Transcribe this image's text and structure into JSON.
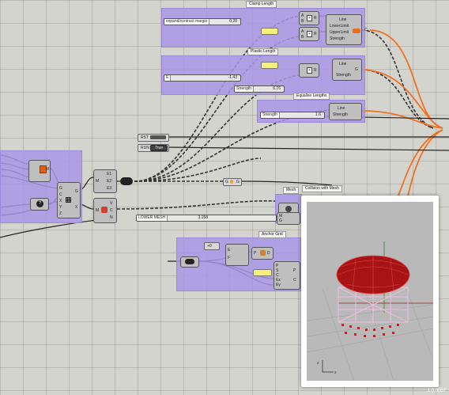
{
  "groups": {
    "clamp": "Clamp Length",
    "plastic": "Plastic Length",
    "equalise": "Equalise Lengths",
    "collision": "Collision with Mesh",
    "mesh": "Mesh",
    "anchor": "Anchor Grid"
  },
  "clamp": {
    "slider_label": "expand/contract margin",
    "slider_value": "0.20",
    "outputs": [
      "Line",
      "LowerLimit",
      "UpperLimit",
      "Strength"
    ],
    "inputs1": [
      "A",
      "B"
    ],
    "inputs2": [
      "A",
      "B"
    ],
    "out_r": "R",
    "out_c": "C"
  },
  "plastic": {
    "slider_label": "E",
    "slider_value": "-1.43",
    "strength_label": "Strength",
    "strength_value": "6.76",
    "outputs": [
      "Line",
      "Strength"
    ],
    "out_r": "R",
    "out_g": "G"
  },
  "equalise": {
    "strength_label": "Strength",
    "strength_value": "1.6",
    "outputs": [
      "Line",
      "Strength"
    ]
  },
  "controls": {
    "rst": "RST",
    "run": "RUN",
    "run_value": "True"
  },
  "left": {
    "inputs": [
      "G",
      "C",
      "X",
      "Y",
      "Z"
    ],
    "outputs": [
      "G",
      "X"
    ],
    "m_label": "M",
    "c_label": "C",
    "z_label": "Z"
  },
  "explode": {
    "outputs": [
      "E1",
      "E2",
      "E3"
    ],
    "input": "M"
  },
  "mesh_split": {
    "inputs": [
      "M"
    ],
    "outputs": [
      "V",
      "C",
      "N"
    ]
  },
  "gate": {
    "left": "G",
    "right": "G"
  },
  "mesh": {
    "lower_label": "LOWER MESH",
    "lower_value": "3.158",
    "inputs": [
      "M",
      "G"
    ]
  },
  "anchor": {
    "inputs_top": [
      "E",
      "F"
    ],
    "inputs_mid": [
      "P",
      "S",
      "C",
      "Ex",
      "Ey"
    ],
    "outputs": [
      "P",
      "C"
    ],
    "dx": "+0",
    "n_label": "S",
    "values": [
      "P",
      "D"
    ]
  },
  "version": "1.0.0007",
  "colors": {
    "group": "#a896e6",
    "canvas": "#d4d4cf",
    "wire_orange": "#f07020",
    "wire_dark": "#333333",
    "mesh_red": "#c41818",
    "panel_yellow": "#f6f078"
  }
}
